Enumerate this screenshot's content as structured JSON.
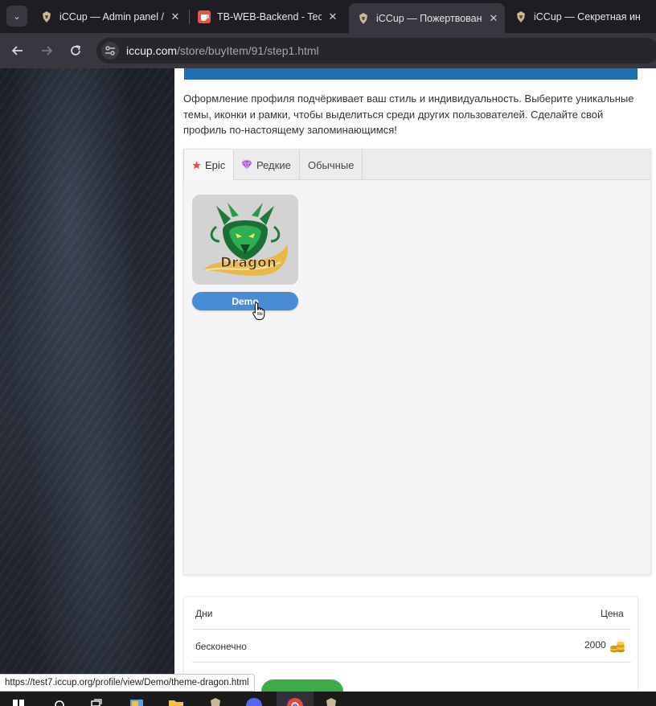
{
  "browser": {
    "tabs": [
      {
        "title": "iCCup — Admin panel /",
        "active": false,
        "favicon": "iccup-knight-icon"
      },
      {
        "title": "TB-WEB-Backend - Tech",
        "active": false,
        "favicon": "cup-icon"
      },
      {
        "title": "iCCup — Пожертвован",
        "active": true,
        "favicon": "iccup-knight-icon"
      },
      {
        "title": "iCCup — Секретная ин",
        "active": false,
        "favicon": "iccup-knight-icon"
      }
    ],
    "tab_close": "✕",
    "url_host": "iccup.com",
    "url_path": "/store/buyItem/91/step1.html"
  },
  "page": {
    "description": "Оформление профиля подчёркивает ваш стиль и индивидуальность. Выберите уникальные темы, иконки и рамки, чтобы выделиться среди других пользователей. Сделайте свой профиль по-настоящему запоминающимся!",
    "rarity_tabs": [
      {
        "label": "Epic",
        "icon": "star-icon",
        "active": true
      },
      {
        "label": "Редкие",
        "icon": "gem-icon",
        "active": false
      },
      {
        "label": "Обычные",
        "icon": "",
        "active": false
      }
    ],
    "item": {
      "image_text": "Dragon",
      "button_label": "Demo"
    },
    "price_table": {
      "col_days": "Дни",
      "col_price": "Цена",
      "row_days": "бесконечно",
      "row_price": "2000",
      "price_icon": "gold-coins-icon"
    }
  },
  "status_bar": {
    "link_url": "https://test7.iccup.org/profile/view/Demo/theme-dragon.html"
  },
  "colors": {
    "demo_button": "#4a8bd6",
    "banner": "#1f6fb2",
    "epic_star": "#e0524a",
    "rare_gem": "#b44fe0",
    "buy_button": "#3cab4a"
  }
}
